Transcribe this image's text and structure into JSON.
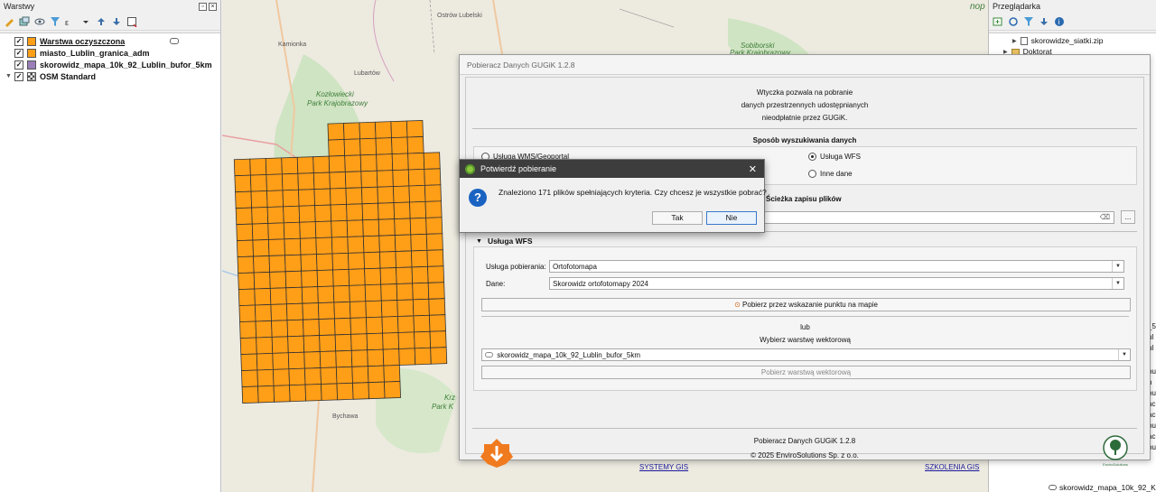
{
  "layers_panel": {
    "title": "Warstwy",
    "layers": [
      {
        "name": "Warstwa oczyszczona",
        "color": "#ff9e17",
        "checked": true
      },
      {
        "name": "miasto_Lublin_granica_adm",
        "color": "#ff9e17",
        "checked": true
      },
      {
        "name": "skorowidz_mapa_10k_92_Lublin_bufor_5km",
        "color": "#9a7fb8",
        "checked": true
      },
      {
        "name": "OSM Standard",
        "checked": true
      }
    ]
  },
  "map": {
    "labels": {
      "ostrow": "Ostrów Lubelski",
      "kamionka": "Kamionka",
      "lubartow": "Lubartów",
      "kozlowiecki": "Kozłowiecki",
      "park_kraj": "Park Krajobrazowy",
      "sobiborski": "Sobiborski",
      "park_kraj2": "Park Krajobrazowy",
      "bychawa": "Bychawa",
      "krz": "Krz",
      "park_k": "Park K",
      "nop": "nop"
    },
    "grid_color": "#ff9e17"
  },
  "browser_panel": {
    "title": "Przeglądarka",
    "items": [
      "skorowidze_siatki.zip",
      "Doktorat"
    ],
    "bottom_item": "skorowidz_mapa_10k_92_Kra",
    "fragments": [
      "_5",
      "ul",
      "ul",
      "bu",
      "n",
      "bu",
      "ac",
      "ac",
      "bu",
      "ac",
      "bu"
    ]
  },
  "plugin": {
    "title": "Pobieracz Danych GUGiK 1.2.8",
    "intro": [
      "Wtyczka pozwala na pobranie",
      "danych przestrzennych udostępnianych",
      "nieodpłatnie przez GUGiK."
    ],
    "search_method_title": "Sposób wyszukiwania danych",
    "radio_wms": "Usługa WMS/Geoportal",
    "radio_wfs": "Usługa WFS",
    "radio_other": "Inne dane",
    "save_path_title": "Ścieżka zapisu plików",
    "browse_button": "...",
    "wfs_section_title": "Usługa WFS",
    "service_label": "Usługa pobierania:",
    "service_value": "Ortofotomapa",
    "data_label": "Dane:",
    "data_value": "Skorowidz ortofotomapy 2024",
    "point_button": "Pobierz przez wskazanie punktu na mapie",
    "or_text": "lub",
    "choose_layer_text": "Wybierz warstwę wektorową",
    "layer_value": "skorowidz_mapa_10k_92_Lublin_bufor_5km",
    "layer_button": "Pobierz warstwą wektorową",
    "footer_name": "Pobieracz Danych GUGiK 1.2.8",
    "footer_copy": "© 2025 EnviroSolutions Sp. z o.o.",
    "link_systemy": "SYSTEMY GIS",
    "link_szkolenia": "SZKOLENIA GIS",
    "logo_label": "EnviroSolutions"
  },
  "confirm": {
    "title": "Potwierdź pobieranie",
    "message": "Znaleziono 171 plików spełniających kryteria. Czy chcesz je wszystkie pobrać?",
    "yes": "Tak",
    "no": "Nie"
  }
}
